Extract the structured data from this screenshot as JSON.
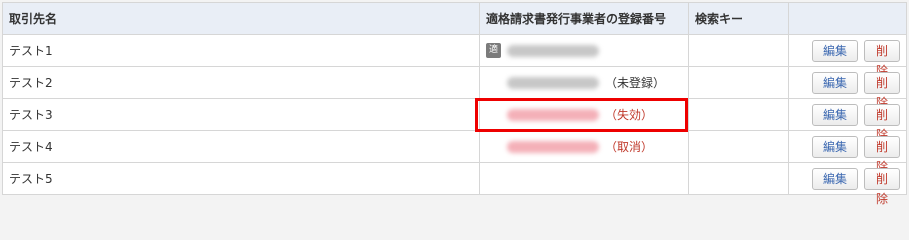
{
  "table": {
    "headers": {
      "partner": "取引先名",
      "registration": "適格請求書発行事業者の登録番号",
      "search_key": "検索キー",
      "actions": ""
    },
    "rows": [
      {
        "name": "テスト1",
        "badge": "適",
        "status": "",
        "status_tone": "normal",
        "edit_label": "編集",
        "delete_label": "削除"
      },
      {
        "name": "テスト2",
        "badge": "",
        "status": "（未登録）",
        "status_tone": "normal",
        "edit_label": "編集",
        "delete_label": "削除"
      },
      {
        "name": "テスト3",
        "badge": "",
        "status": "（失効）",
        "status_tone": "warn",
        "edit_label": "編集",
        "delete_label": "削除"
      },
      {
        "name": "テスト4",
        "badge": "",
        "status": "（取消）",
        "status_tone": "warn",
        "edit_label": "編集",
        "delete_label": "削除"
      },
      {
        "name": "テスト5",
        "badge": "",
        "status": "",
        "status_tone": "normal",
        "edit_label": "編集",
        "delete_label": "削除"
      }
    ]
  },
  "colors": {
    "header_bg": "#e9eef6",
    "edit_text": "#3a67b0",
    "delete_text": "#c0392b",
    "highlight_border": "#ee0000",
    "warn_text": "#c0392b"
  }
}
